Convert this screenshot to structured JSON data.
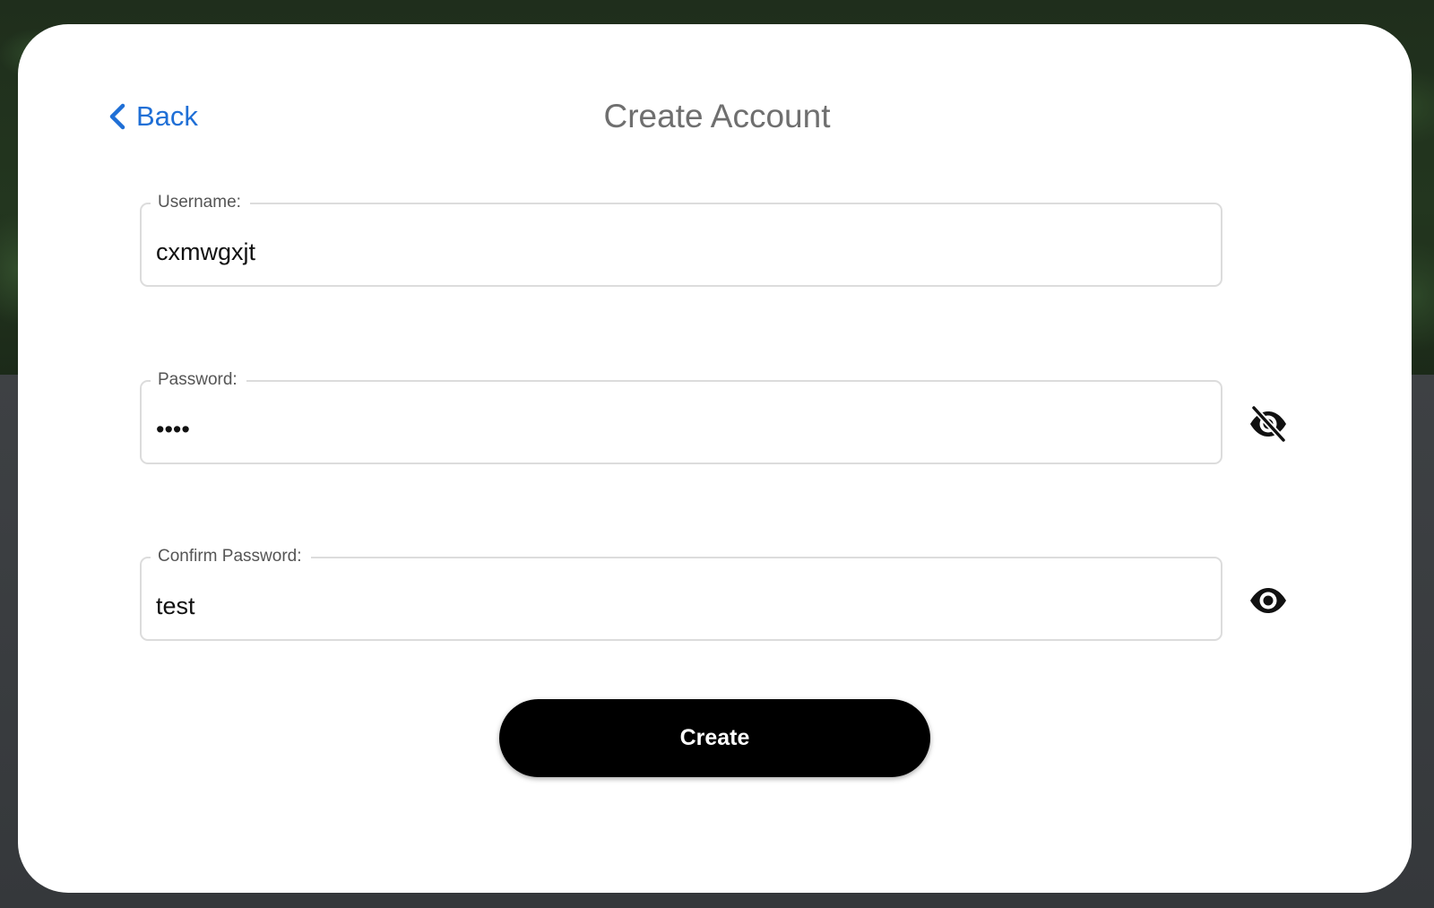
{
  "header": {
    "back_label": "Back",
    "title": "Create Account"
  },
  "form": {
    "username": {
      "label": "Username:",
      "value": "cxmwgxjt"
    },
    "password": {
      "label": "Password:",
      "value": "test",
      "visibility_icon": "eye-slash-icon"
    },
    "confirm_password": {
      "label": "Confirm Password:",
      "value": "test",
      "visibility_icon": "eye-icon"
    },
    "submit_label": "Create"
  },
  "colors": {
    "link": "#1f6fd6",
    "title": "#6f6f6f",
    "button_bg": "#000000",
    "button_text": "#ffffff"
  }
}
